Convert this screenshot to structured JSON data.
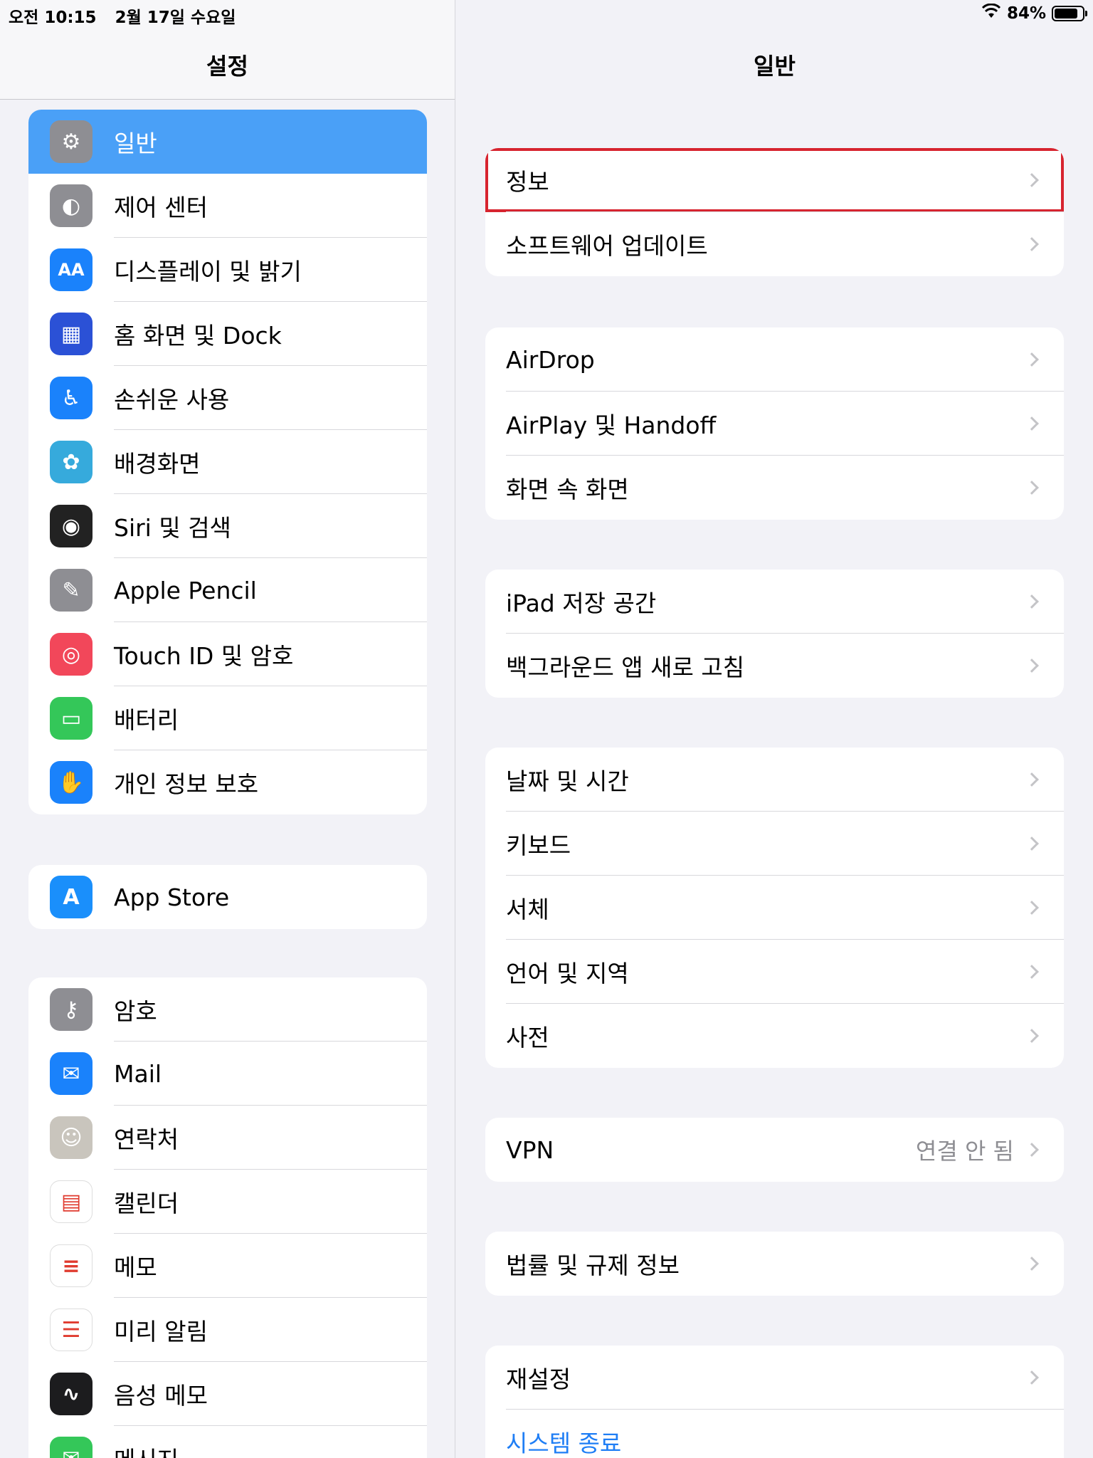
{
  "status": {
    "time": "오전 10:15",
    "date": "2월 17일 수요일",
    "battery": "84%",
    "battery_level": 0.84
  },
  "sidebar": {
    "title": "설정",
    "groups": [
      [
        {
          "label": "일반",
          "icon": "gear-icon",
          "color": "#8e8e93",
          "selected": true
        },
        {
          "label": "제어 센터",
          "icon": "toggles-icon",
          "color": "#8e8e93"
        },
        {
          "label": "디스플레이 및 밝기",
          "icon": "text-size-icon",
          "color": "#1a82fb"
        },
        {
          "label": "홈 화면 및 Dock",
          "icon": "home-grid-icon",
          "color": "#2b51d6"
        },
        {
          "label": "손쉬운 사용",
          "icon": "accessibility-icon",
          "color": "#1a82fb"
        },
        {
          "label": "배경화면",
          "icon": "flower-icon",
          "color": "#36aadc"
        },
        {
          "label": "Siri 및 검색",
          "icon": "siri-icon",
          "color": "#222"
        },
        {
          "label": "Apple Pencil",
          "icon": "pencil-icon",
          "color": "#8e8e93"
        },
        {
          "label": "Touch ID 및 암호",
          "icon": "fingerprint-icon",
          "color": "#f2475a"
        },
        {
          "label": "배터리",
          "icon": "battery-icon",
          "color": "#34c759"
        },
        {
          "label": "개인 정보 보호",
          "icon": "hand-icon",
          "color": "#1a82fb"
        }
      ],
      [
        {
          "label": "App Store",
          "icon": "appstore-icon",
          "color": "#1a8ffb"
        }
      ],
      [
        {
          "label": "암호",
          "icon": "key-icon",
          "color": "#8e8e93"
        },
        {
          "label": "Mail",
          "icon": "mail-icon",
          "color": "#1a82fb"
        },
        {
          "label": "연락처",
          "icon": "contacts-icon",
          "color": "#c9c5bd"
        },
        {
          "label": "캘린더",
          "icon": "calendar-icon",
          "color": "#ffffff"
        },
        {
          "label": "메모",
          "icon": "notes-icon",
          "color": "#ffffff"
        },
        {
          "label": "미리 알림",
          "icon": "reminders-icon",
          "color": "#ffffff"
        },
        {
          "label": "음성 메모",
          "icon": "voice-memo-icon",
          "color": "#1c1c1e"
        },
        {
          "label": "메시지",
          "icon": "messages-icon",
          "color": "#34c759"
        }
      ]
    ]
  },
  "detail": {
    "title": "일반",
    "groups": [
      [
        {
          "label": "정보",
          "highlight": true
        },
        {
          "label": "소프트웨어 업데이트"
        }
      ],
      [
        {
          "label": "AirDrop"
        },
        {
          "label": "AirPlay 및 Handoff"
        },
        {
          "label": "화면 속 화면"
        }
      ],
      [
        {
          "label": "iPad 저장 공간"
        },
        {
          "label": "백그라운드 앱 새로 고침"
        }
      ],
      [
        {
          "label": "날짜 및 시간"
        },
        {
          "label": "키보드"
        },
        {
          "label": "서체"
        },
        {
          "label": "언어 및 지역"
        },
        {
          "label": "사전"
        }
      ],
      [
        {
          "label": "VPN",
          "value": "연결 안 됨"
        }
      ],
      [
        {
          "label": "법률 및 규제 정보"
        }
      ],
      [
        {
          "label": "재설정"
        },
        {
          "label": "시스템 종료",
          "blue": true,
          "nochevron": true
        }
      ]
    ]
  }
}
